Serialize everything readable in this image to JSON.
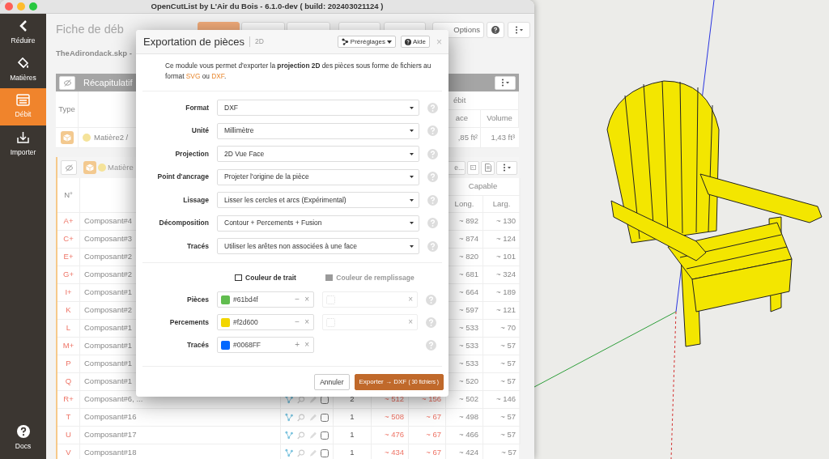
{
  "window": {
    "title": "OpenCutList by L'Air du Bois - 6.1.0-dev ( build: 202403021124 )"
  },
  "sidebar": {
    "items": [
      {
        "label": "Réduire",
        "selected": false
      },
      {
        "label": "Matières",
        "selected": false
      },
      {
        "label": "Débit",
        "selected": true
      },
      {
        "label": "Importer",
        "selected": false
      }
    ],
    "footer": {
      "label": "Docs"
    }
  },
  "page": {
    "title": "Fiche de déb",
    "toolbar": [
      {
        "kind": "primary"
      },
      {
        "kind": "default"
      },
      {
        "kind": "default"
      },
      {
        "kind": "default"
      },
      {
        "kind": "default"
      }
    ],
    "options": "Options",
    "file_label": "TheAdirondack.skp -"
  },
  "summary": {
    "title": "Récapitulatif",
    "type_header": "Type",
    "group_header": "ébit",
    "surface_header": "ace",
    "volume_header": "Volume",
    "rows": [
      {
        "material": "Matière2 /",
        "surface": ",85 ft²",
        "volume": "1,43 ft³"
      }
    ]
  },
  "group": {
    "material": "Matière",
    "button": "e...",
    "number_header": "N°",
    "capable_header": "Capable",
    "length_header": "Long.",
    "width_header": "Larg.",
    "rows": [
      {
        "n": "A+",
        "name": "Composant#4",
        "cap_length": "~ 892",
        "cap_width": "~ 130"
      },
      {
        "n": "C+",
        "name": "Composant#3",
        "cap_length": "~ 874",
        "cap_width": "~ 124"
      },
      {
        "n": "E+",
        "name": "Composant#2",
        "cap_length": "~ 820",
        "cap_width": "~ 101"
      },
      {
        "n": "G+",
        "name": "Composant#2",
        "cap_length": "~ 681",
        "cap_width": "~ 324"
      },
      {
        "n": "I+",
        "name": "Composant#1",
        "cap_length": "~ 664",
        "cap_width": "~ 189"
      },
      {
        "n": "K",
        "name": "Composant#2",
        "cap_length": "~ 597",
        "cap_width": "~ 121"
      },
      {
        "n": "L",
        "name": "Composant#1",
        "cap_length": "~ 533",
        "cap_width": "~ 70"
      },
      {
        "n": "M+",
        "name": "Composant#1",
        "cap_length": "~ 533",
        "cap_width": "~ 57"
      },
      {
        "n": "P",
        "name": "Composant#1",
        "cap_length": "~ 533",
        "cap_width": "~ 57"
      },
      {
        "n": "Q",
        "name": "Composant#1",
        "cap_length": "~ 520",
        "cap_width": "~ 57"
      },
      {
        "n": "R+",
        "name": "Composant#6, ...",
        "count": "2",
        "length": "~ 512",
        "width": "~ 156",
        "cap_length": "~ 502",
        "cap_width": "~ 146",
        "checked": false
      },
      {
        "n": "T",
        "name": "Composant#16",
        "count": "1",
        "length": "~ 508",
        "width": "~ 67",
        "cap_length": "~ 498",
        "cap_width": "~ 57",
        "checked": false
      },
      {
        "n": "U",
        "name": "Composant#17",
        "count": "1",
        "length": "~ 476",
        "width": "~ 67",
        "cap_length": "~ 466",
        "cap_width": "~ 57",
        "checked": false
      },
      {
        "n": "V",
        "name": "Composant#18",
        "count": "1",
        "length": "~ 434",
        "width": "~ 67",
        "cap_length": "~ 424",
        "cap_width": "~ 57",
        "checked": false
      }
    ]
  },
  "dialog": {
    "title": "Exportation de pièces",
    "subtitle": "2D",
    "presets_button": "Préréglages",
    "help_button": "Aide",
    "close": "×",
    "intro": [
      {
        "kind": "plain",
        "text": "Ce module vous permet d’exporter la "
      },
      {
        "kind": "bold",
        "text": "projection 2D"
      },
      {
        "kind": "plain",
        "text": " des pièces sous forme de fichiers au format "
      },
      {
        "kind": "accent",
        "text": "SVG"
      },
      {
        "kind": "plain",
        "text": " ou "
      },
      {
        "kind": "accent",
        "text": "DXF"
      },
      {
        "kind": "plain",
        "text": "."
      }
    ],
    "fields": [
      {
        "label": "Format",
        "value": "DXF"
      },
      {
        "label": "Unité",
        "value": "Millimètre"
      },
      {
        "label": "Projection",
        "value": "2D Vue Face"
      },
      {
        "label": "Point d'ancrage",
        "value": "Projeter l'origine de la pièce"
      },
      {
        "label": "Lissage",
        "value": "Lisser les cercles et arcs (Expérimental)"
      },
      {
        "label": "Décomposition",
        "value": "Contour + Percements + Fusion"
      },
      {
        "label": "Tracés",
        "value": "Utiliser les arêtes non associées à une face"
      }
    ],
    "color_headers": [
      {
        "label": "Couleur de trait",
        "disabled": false
      },
      {
        "label": "Couleur de remplissage",
        "disabled": true
      }
    ],
    "color_rows": [
      {
        "label": "Pièces",
        "stroke": {
          "color": "#61bd4f",
          "value": "#61bd4f",
          "action": "−",
          "clear": "×"
        },
        "fill": {
          "disabled": true,
          "clear": "×"
        }
      },
      {
        "label": "Percements",
        "stroke": {
          "color": "#f2d600",
          "value": "#f2d600",
          "action": "−",
          "clear": "×"
        },
        "fill": {
          "disabled": true,
          "clear": "×"
        }
      },
      {
        "label": "Tracés",
        "stroke": {
          "color": "#0068ff",
          "value": "#0068FF",
          "action": "+",
          "clear": "×"
        }
      }
    ],
    "cancel": "Annuler",
    "export": {
      "label": "Exporter → DXF",
      "note": "( 30 fichiers )"
    }
  }
}
